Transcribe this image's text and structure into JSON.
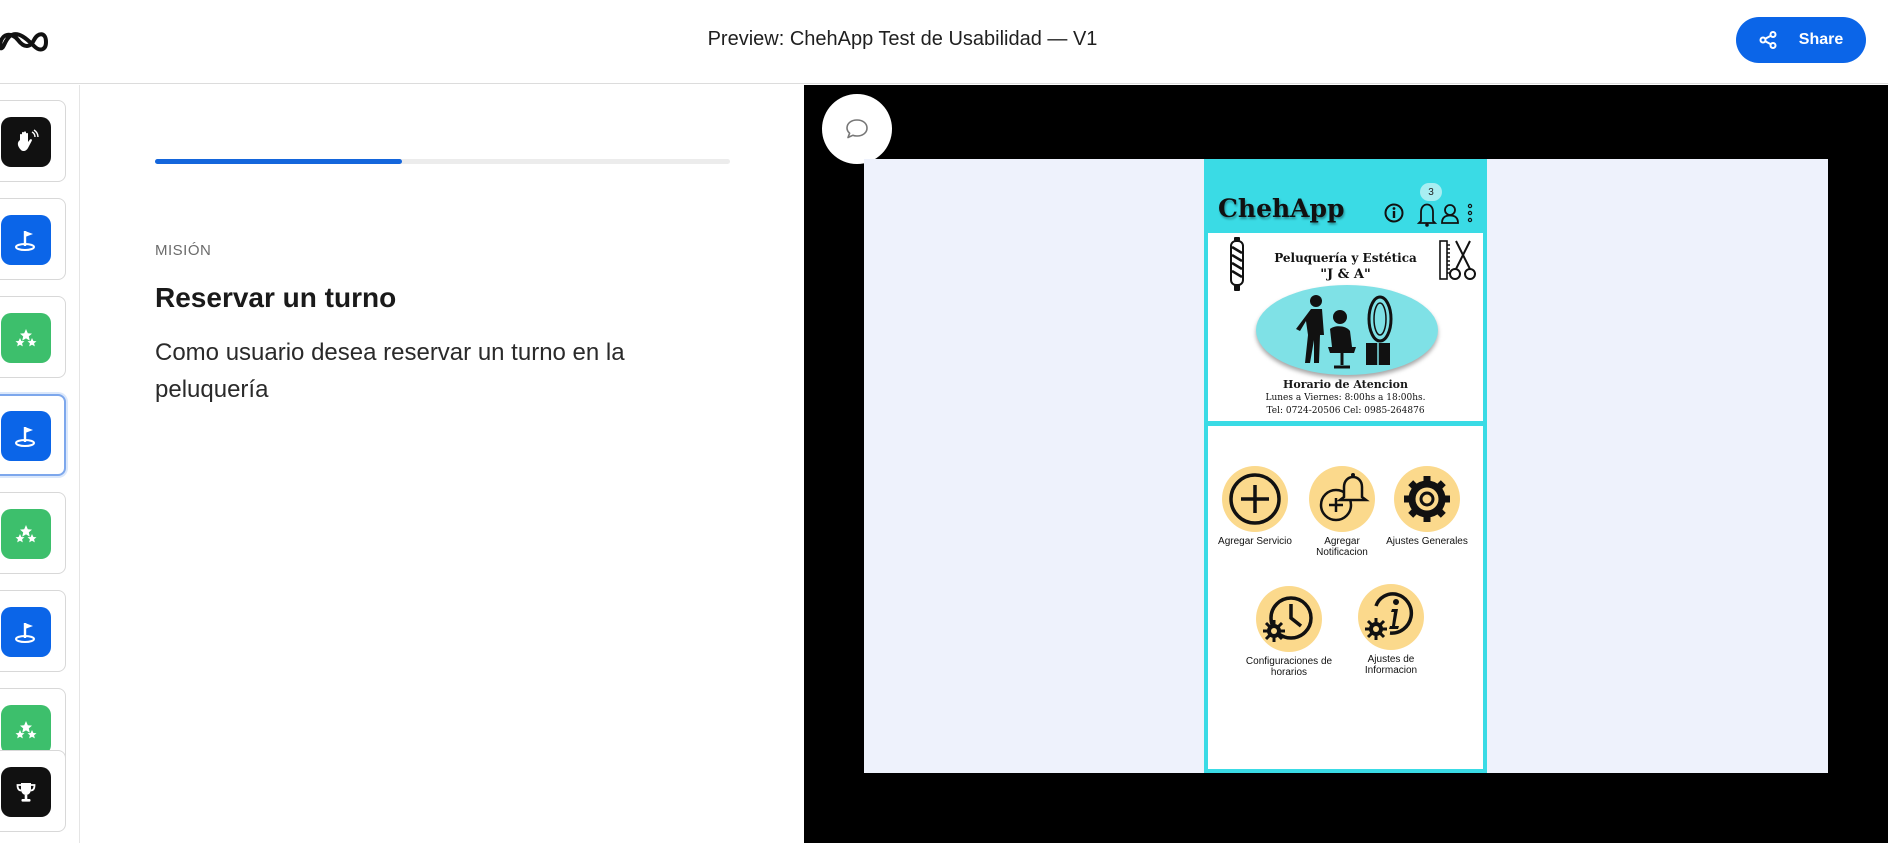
{
  "header": {
    "title": "Preview: ChehApp Test de Usabilidad — V1",
    "share_label": "Share"
  },
  "rail": {
    "steps": [
      {
        "icon": "wave-hand-icon",
        "color": "#111111"
      },
      {
        "icon": "flag-icon",
        "color": "#0b65e8"
      },
      {
        "icon": "stars-icon",
        "color": "#3dbf6c"
      },
      {
        "icon": "flag-icon",
        "color": "#0b65e8",
        "active": true
      },
      {
        "icon": "stars-icon",
        "color": "#3dbf6c"
      },
      {
        "icon": "flag-icon",
        "color": "#0b65e8"
      },
      {
        "icon": "stars-icon",
        "color": "#3dbf6c"
      },
      {
        "icon": "trophy-icon",
        "color": "#111111"
      }
    ]
  },
  "mission": {
    "progress": 0.43,
    "label": "MISIÓN",
    "title": "Reservar un turno",
    "description": "Como usuario desea reservar un turno en la peluquería"
  },
  "prototype": {
    "app_name": "ChehApp",
    "notification_count": "3",
    "salon_name": "Peluquería y Estética",
    "salon_tagline": "\"J & A\"",
    "hours_title": "Horario de Atencion",
    "hours_line": "Lunes a Viernes:  8:00hs a 18:00hs.",
    "contact_line": "Tel: 0724-20506     Cel: 0985-264876",
    "menu": [
      {
        "label": "Agregar Servicio",
        "icon": "plus-icon"
      },
      {
        "label": "Agregar Notificacion",
        "icon": "bell-plus-icon"
      },
      {
        "label": "Ajustes Generales",
        "icon": "gear-icon"
      },
      {
        "label": "Configuraciones de horarios",
        "icon": "clock-gear-icon"
      },
      {
        "label": "Ajustes de Informacion",
        "icon": "info-gear-icon"
      }
    ]
  },
  "colors": {
    "accent": "#0b65e8",
    "phone_header": "#3adbe5",
    "tile": "#fbd98c"
  }
}
